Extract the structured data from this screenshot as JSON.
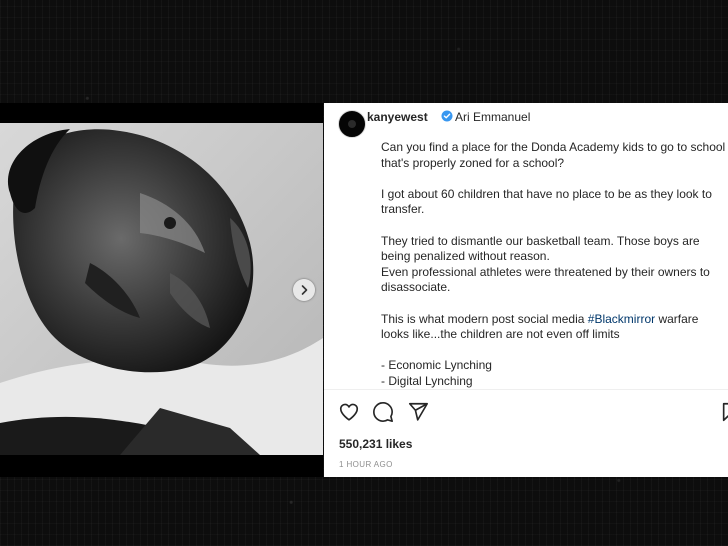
{
  "post": {
    "username": "kanyewest",
    "coauthor": "Ari Emmanuel",
    "caption": {
      "para1": [
        "Can you find a place for the Donda Academy kids to go to school",
        "that's properly zoned for a school?"
      ],
      "para2": [
        "I got about 60 children that have no place to be as they look to",
        "transfer."
      ],
      "para3": [
        "They tried to dismantle our basketball team. Those boys are",
        "being penalized without reason.",
        "Even professional athletes were threatened by their owners to",
        "disassociate."
      ],
      "para4": {
        "prefix": "This is what modern post social media ",
        "hashtag": "#Blackmirror",
        "suffix": " warfare",
        "line2": "looks like...the children are not even off limits"
      },
      "para5": [
        "- Economic Lynching",
        "- Digital Lynching"
      ]
    },
    "likes": "550,231 likes",
    "timestamp": "1 HOUR AGO"
  },
  "icons": {
    "verified": "verified-badge-icon",
    "like": "heart-icon",
    "comment": "comment-icon",
    "share": "send-icon",
    "save": "bookmark-icon",
    "next": "chevron-right-icon"
  },
  "colors": {
    "verified": "#3897f0",
    "hashtag": "#00376b",
    "text": "#262626",
    "muted": "#8e8e8e"
  }
}
